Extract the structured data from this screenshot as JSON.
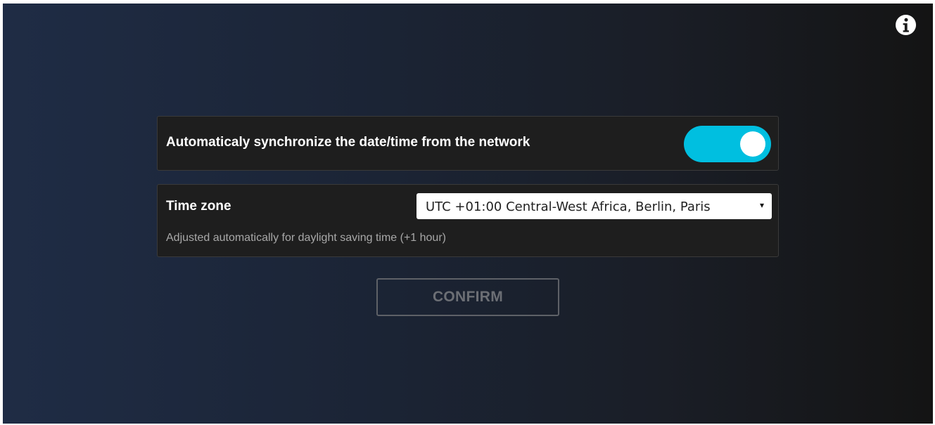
{
  "info": {
    "icon": "info-circle-icon"
  },
  "sync": {
    "label": "Automaticaly synchronize the date/time from the network",
    "enabled": true,
    "toggle_color": "#00bfe0"
  },
  "timezone": {
    "label": "Time zone",
    "selected": "UTC +01:00 Central-West Africa, Berlin, Paris",
    "dropdown_icon": "caret-down-icon",
    "arrow_glyph": "▾",
    "note": "Adjusted automatically for daylight saving time (+1 hour)"
  },
  "confirm": {
    "label": "CONFIRM",
    "enabled": false
  }
}
